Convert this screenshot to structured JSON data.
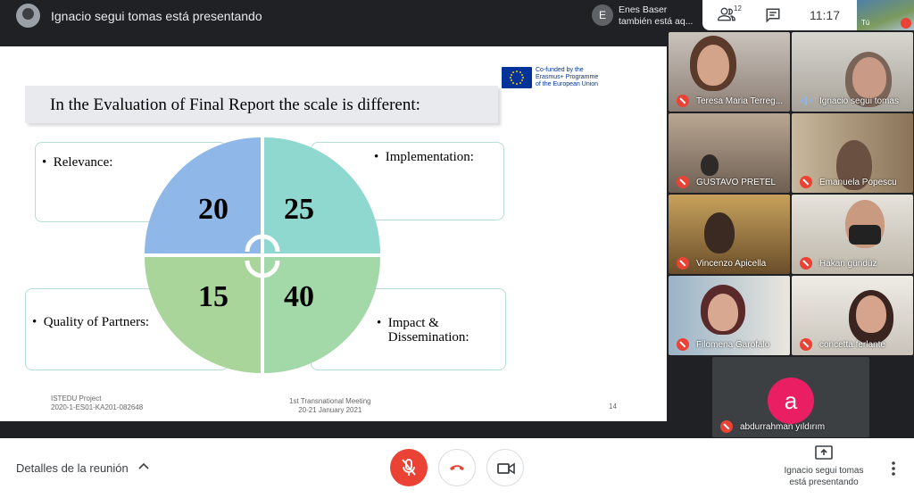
{
  "header": {
    "presenting_text": "Ignacio segui tomas está presentando",
    "notification_avatar": "E",
    "notification_text": "Enes Baser\ntambién está aq...",
    "participants_count": "12",
    "time": "11:17",
    "self_label": "Tú"
  },
  "slide": {
    "eu_text": "Co-funded by the\nErasmus+ Programme\nof the European Union",
    "title": "In the Evaluation of Final Report the scale is different:",
    "boxes": {
      "relevance": "Relevance:",
      "implementation": "Implementation:",
      "quality": "Quality of Partners:",
      "impact": "Impact &\nDissemination:"
    },
    "scores": {
      "relevance": "20",
      "implementation": "25",
      "quality": "15",
      "impact": "40"
    },
    "footer_left": "ISTEDU Project\n2020-1-ES01-KA201-082648",
    "footer_center": "1st Transnational Meeting\n20-21 January 2021",
    "page_number": "14"
  },
  "participants": [
    {
      "name": "Teresa Maria Terreg...",
      "muted": true
    },
    {
      "name": "Ignacio segui tomas",
      "muted": false
    },
    {
      "name": "GUSTAVO PRETEL",
      "muted": true
    },
    {
      "name": "Emanuela Popescu",
      "muted": true
    },
    {
      "name": "Vincenzo Apicella",
      "muted": true
    },
    {
      "name": "Hakan gündüz",
      "muted": true
    },
    {
      "name": "Filomena Garofalo",
      "muted": true
    },
    {
      "name": "concetta ferlante",
      "muted": true
    }
  ],
  "solo_participant": {
    "initial": "a",
    "name": "abdurrahman yıldırım"
  },
  "footer": {
    "details_label": "Detalles de la reunión",
    "presenting_label": "Ignacio segui tomas\nestá presentando"
  },
  "colors": {
    "mic_off": "#ea4335",
    "avatar_a": "#e91e63",
    "quad_relevance": "#8fb8e8",
    "quad_implementation": "#8fd8cf",
    "quad_quality": "#a9d49a",
    "quad_impact": "#a3d8a8"
  }
}
